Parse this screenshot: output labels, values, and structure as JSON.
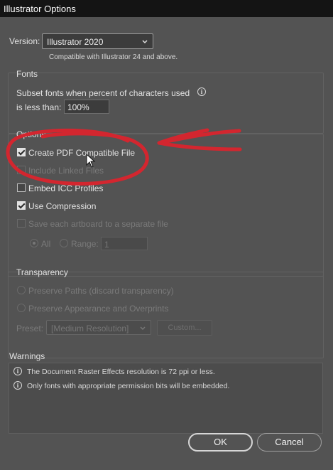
{
  "window": {
    "title": "Illustrator Options"
  },
  "version": {
    "label": "Version:",
    "selected": "Illustrator 2020",
    "note": "Compatible with Illustrator 24 and above."
  },
  "fonts": {
    "heading": "Fonts",
    "subset_line1": "Subset fonts when percent of characters used",
    "subset_line2": "is less than:",
    "subset_value": "100%"
  },
  "options": {
    "heading": "Options",
    "items": [
      {
        "label": "Create PDF Compatible File",
        "checked": true,
        "enabled": true
      },
      {
        "label": "Include Linked Files",
        "checked": false,
        "enabled": false
      },
      {
        "label": "Embed ICC Profiles",
        "checked": false,
        "enabled": true
      },
      {
        "label": "Use Compression",
        "checked": true,
        "enabled": true
      },
      {
        "label": "Save each artboard to a separate file",
        "checked": false,
        "enabled": false
      }
    ],
    "all_label": "All",
    "range_label": "Range:",
    "range_value": "1"
  },
  "transparency": {
    "heading": "Transparency",
    "preserve_paths": "Preserve Paths (discard transparency)",
    "preserve_appearance": "Preserve Appearance and Overprints",
    "preset_label": "Preset:",
    "preset_value": "[Medium Resolution]",
    "custom_label": "Custom..."
  },
  "warnings": {
    "heading": "Warnings",
    "items": [
      "The Document Raster Effects resolution is 72 ppi or less.",
      "Only fonts with appropriate permission bits will be embedded."
    ]
  },
  "buttons": {
    "ok": "OK",
    "cancel": "Cancel"
  },
  "annotation_color": "#d3262f"
}
